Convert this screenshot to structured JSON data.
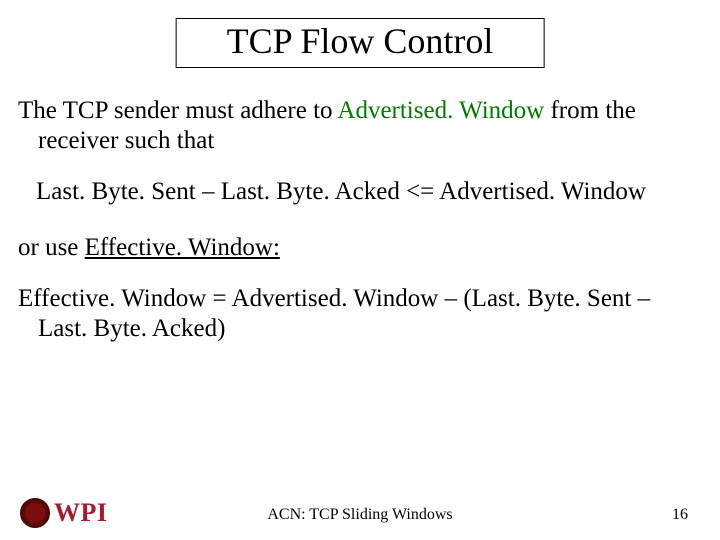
{
  "title": "TCP Flow Control",
  "body": {
    "p1_pre": "The TCP sender must adhere to ",
    "p1_green": "Advertised. Window",
    "p1_post": " from the receiver such that",
    "formula1": "Last. Byte. Sent – Last. Byte. Acked <= Advertised. Window",
    "p2_pre": "or use ",
    "p2_link": "Effective. Window:",
    "p3": "Effective. Window = Advertised. Window – (Last. Byte. Sent – Last. Byte. Acked)"
  },
  "footer": {
    "logo_text": "WPI",
    "center": "ACN: TCP Sliding Windows",
    "page": "16"
  }
}
